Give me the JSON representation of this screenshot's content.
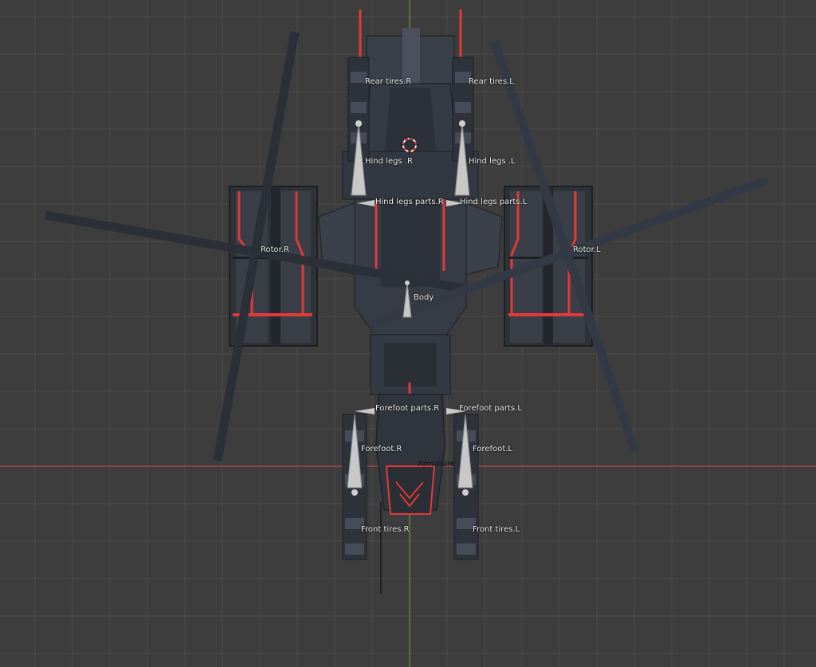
{
  "viewport": {
    "background_color": "#3d3d3d",
    "grid_color": "#4c4c4c",
    "x_axis_color": "#b64a4a",
    "y_axis_color": "#6a9b3a"
  },
  "object": {
    "armature_label": "Armature",
    "body_color": "#2f353e",
    "accent_color": "#e03a3a",
    "rotor_blade_color": "#2a2f38"
  },
  "bones": {
    "rear_tires_r": "Rear tires.R",
    "rear_tires_l": "Rear tires.L",
    "hind_legs_r": "Hind legs .R",
    "hind_legs_l": "Hind legs .L",
    "hind_legs_parts_r": "Hind legs parts.R",
    "hind_legs_parts_l": "Hind legs parts.L",
    "rotor_r": "Rotor.R",
    "rotor_l": "Rotor.L",
    "body": "Body",
    "forefoot_parts_r": "Forefoot parts.R",
    "forefoot_parts_l": "Forefoot parts.L",
    "forefoot_r": "Forefoot.R",
    "forefoot_l": "Forefoot.L",
    "front_tires_r": "Front  tires.R",
    "front_tires_l": "Front  tires.L"
  }
}
